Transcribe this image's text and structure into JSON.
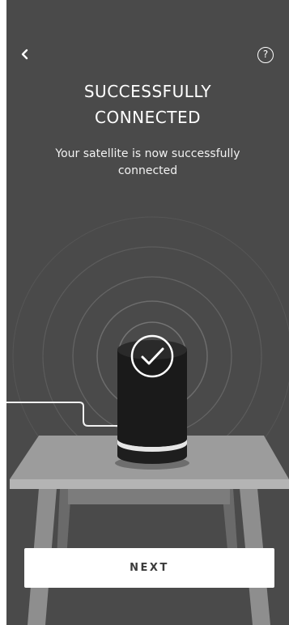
{
  "header": {
    "back_icon": "chevron-left-icon",
    "help_icon": "question-circle-icon",
    "help_glyph": "?"
  },
  "main": {
    "title_line1": "SUCCESSFULLY",
    "title_line2": "CONNECTED",
    "subtitle_line1": "Your satellite is now successfully",
    "subtitle_line2": "connected",
    "status_icon": "checkmark-circle-icon"
  },
  "footer": {
    "next_label": "NEXT"
  },
  "colors": {
    "background": "#4a4a4a",
    "button_bg": "#ffffff",
    "text": "#ffffff",
    "device": "#1c1c1c",
    "table_top": "#9a9a9a"
  }
}
